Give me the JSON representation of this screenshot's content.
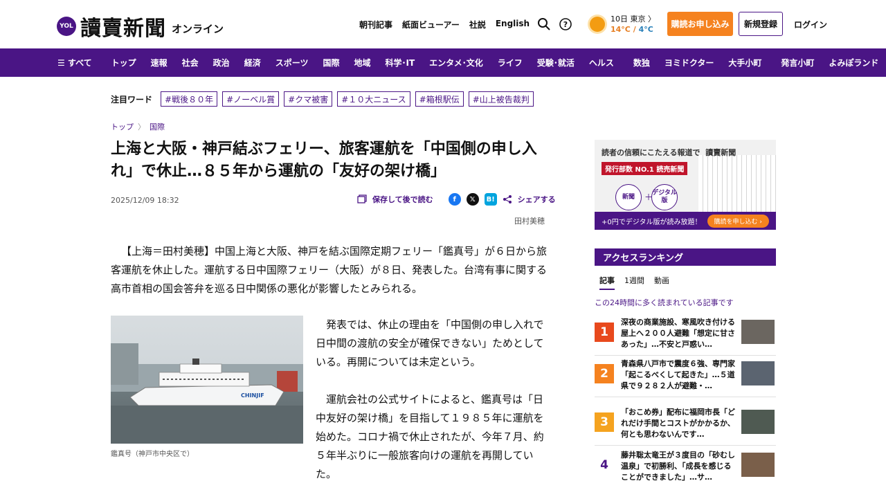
{
  "header": {
    "logo_badge": "YOL",
    "logo_main": "讀賣新聞",
    "logo_sub": "オンライン",
    "links": [
      "朝刊記事",
      "紙面ビューアー",
      "社説",
      "English"
    ],
    "weather_date": "10日 東京 〉",
    "weather_hi": "14°C",
    "weather_sep": "/",
    "weather_lo": "4°C",
    "subscribe": "購読お申し込み",
    "register": "新規登録",
    "login": "ログイン"
  },
  "nav": {
    "all": "☰ すべて",
    "items": [
      "トップ",
      "速報",
      "社会",
      "政治",
      "経済",
      "スポーツ",
      "国際",
      "地域",
      "科学･IT",
      "エンタメ･文化",
      "ライフ",
      "受験･就活",
      "ヘルス"
    ],
    "items2": [
      "数独",
      "ヨミドクター",
      "大手小町"
    ],
    "items3": [
      "発言小町",
      "よみぽランド"
    ]
  },
  "keywords": {
    "label": "注目ワード",
    "tags": [
      "#戦後８０年",
      "#ノーベル賞",
      "#クマ被害",
      "#１０大ニュース",
      "#箱根駅伝",
      "#山上被告裁判"
    ]
  },
  "breadcrumb": {
    "home": "トップ",
    "sep": "〉",
    "section": "国際"
  },
  "article": {
    "title": "上海と大阪・神戸結ぶフェリー、旅客運航を「中国側の申し入れ」で休止…８５年から運航の「友好の架け橋」",
    "date": "2025/12/09 18:32",
    "save": "保存して後で読む",
    "share": "シェアする",
    "author": "田村美穂",
    "lead": "【上海＝田村美穂】中国上海と大阪、神戸を結ぶ国際定期フェリー「鑑真号」が６日から旅客運航を休止した。運航する日中国際フェリー（大阪）が８日、発表した。台湾有事に関する高市首相の国会答弁を巡る日中関係の悪化が影響したとみられる。",
    "photo_ship_label": "CHINJIF",
    "caption": "鑑真号（神戸市中央区で）",
    "p1": "発表では、休止の理由を「中国側の申し入れで日中間の渡航の安全が確保できない」ためとしている。再開については未定という。",
    "p2": "運航会社の公式サイトによると、鑑真号は「日中友好の架け橋」を目指して１９８５年に運航を始めた。コロナ禍で休止されたが、今年７月、約５年半ぶりに一般旅客向けの運航を再開していた。"
  },
  "ad": {
    "headline": "読者の信頼にこたえる報道で",
    "masthead": "讀賣新聞",
    "no1": "発行部数 NO.1 読売新聞",
    "circle1": "新聞",
    "plus": "＋",
    "circle2": "デジタル版",
    "bottom": "+0円でデジタル版が読み放題！",
    "btn": "購読を申し込む ›"
  },
  "ranking": {
    "heading": "アクセスランキング",
    "tabs": [
      "記事",
      "1週間",
      "動画"
    ],
    "sub": "この24時間に多く読まれている記事です",
    "items": [
      {
        "num": "1",
        "text": "深夜の商業施設、寒風吹き付ける屋上へ２００人避難「想定に甘さあった」…不安と戸惑い…",
        "color": "#e8491d"
      },
      {
        "num": "2",
        "text": "青森県八戸市で震度６強、専門家「起こるべくして起きた」…５道県で９２８２人が避難・…",
        "color": "#f5821f"
      },
      {
        "num": "3",
        "text": "「おこめ券」配布に福岡市長「どれだけ手間とコストがかかるか、何とも思わないんです…",
        "color": "#f5a31f"
      },
      {
        "num": "4",
        "text": "藤井聡太竜王が３度目の「砂むし温泉」で初勝利、「成長を感じることができました」…サ…",
        "color": "#fff"
      }
    ]
  },
  "colors": {
    "brand": "#4a1585",
    "accent": "#f5821f"
  }
}
